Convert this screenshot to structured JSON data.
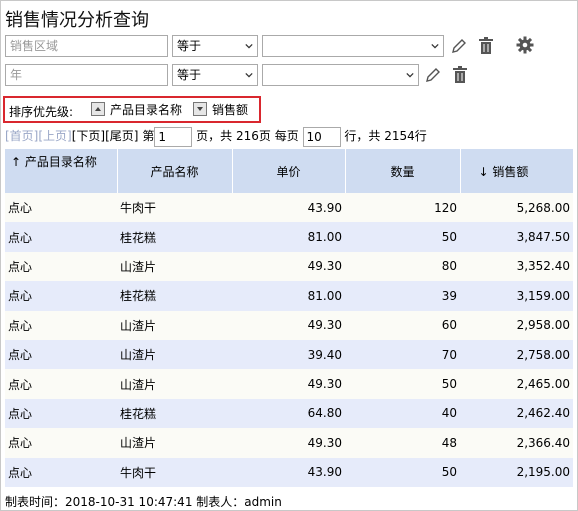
{
  "title": "销售情况分析查询",
  "filters": [
    {
      "field_placeholder": "销售区域",
      "operator": "等于",
      "value": ""
    },
    {
      "field_placeholder": "年",
      "operator": "等于",
      "value": ""
    }
  ],
  "sort": {
    "label": "排序优先级:",
    "items": [
      "产品目录名称",
      "销售额"
    ]
  },
  "pager": {
    "first": "[首页]",
    "prev": "[上页]",
    "next": "[下页]",
    "last": "[尾页]",
    "page_prefix": "第",
    "page": "1",
    "page_suffix": "页，共 216页 每页",
    "per_page": "10",
    "total_suffix": "行，共 2154行"
  },
  "table": {
    "columns": [
      "↑ 产品目录名称",
      "产品名称",
      "单价",
      "数量",
      "↓ 销售额"
    ],
    "rows": [
      [
        "点心",
        "牛肉干",
        "43.90",
        "120",
        "5,268.00"
      ],
      [
        "点心",
        "桂花糕",
        "81.00",
        "50",
        "3,847.50"
      ],
      [
        "点心",
        "山渣片",
        "49.30",
        "80",
        "3,352.40"
      ],
      [
        "点心",
        "桂花糕",
        "81.00",
        "39",
        "3,159.00"
      ],
      [
        "点心",
        "山渣片",
        "49.30",
        "60",
        "2,958.00"
      ],
      [
        "点心",
        "山渣片",
        "39.40",
        "70",
        "2,758.00"
      ],
      [
        "点心",
        "山渣片",
        "49.30",
        "50",
        "2,465.00"
      ],
      [
        "点心",
        "桂花糕",
        "64.80",
        "40",
        "2,462.40"
      ],
      [
        "点心",
        "山渣片",
        "49.30",
        "48",
        "2,366.40"
      ],
      [
        "点心",
        "牛肉干",
        "43.90",
        "50",
        "2,195.00"
      ]
    ]
  },
  "footer": "制表时间：2018-10-31 10:47:41 制表人：admin",
  "icons": [
    "edit-icon",
    "trash-icon",
    "gear-icon"
  ],
  "colors": {
    "header_bg": "#cfdcf1",
    "row_alt": "#e6ebfa",
    "sort_border": "#d9272e"
  }
}
